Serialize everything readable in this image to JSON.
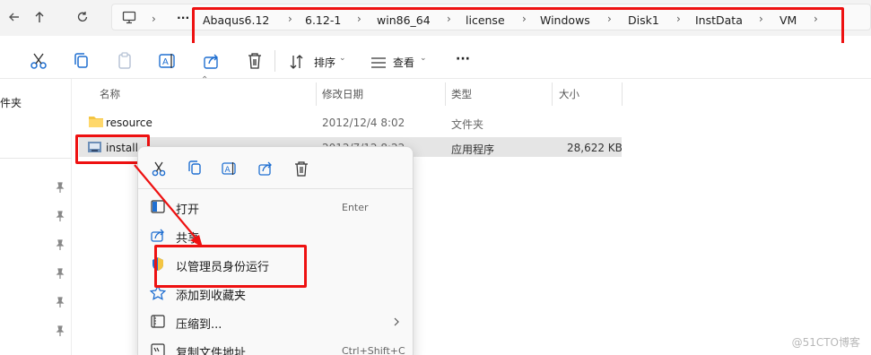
{
  "nav": {
    "back_icon": "arrow-left-icon",
    "up_icon": "arrow-up-icon",
    "refresh_icon": "refresh-icon",
    "pc_icon": "computer-icon",
    "more_path": "···"
  },
  "breadcrumb": [
    "Abaqus6.12",
    "6.12-1",
    "win86_64",
    "license",
    "Windows",
    "Disk1",
    "InstData",
    "VM"
  ],
  "toolbar": {
    "sort_label": "排序",
    "view_label": "查看",
    "more_label": "···"
  },
  "leftnav": {
    "folder_label": "件夹"
  },
  "columns": {
    "name": "名称",
    "modified": "修改日期",
    "type": "类型",
    "size": "大小"
  },
  "files": [
    {
      "name": "resource",
      "modified": "2012/12/4 8:02",
      "type": "文件夹",
      "size": "",
      "icon": "folder-icon"
    },
    {
      "name": "install",
      "modified": "2012/7/12 8:22",
      "type": "应用程序",
      "size": "28,622 KB",
      "icon": "installer-icon"
    }
  ],
  "context_menu": {
    "items": [
      {
        "label": "打开",
        "shortcut": "Enter",
        "icon": "open-icon"
      },
      {
        "label": "共享",
        "shortcut": "",
        "icon": "share-icon"
      },
      {
        "label": "以管理员身份运行",
        "shortcut": "",
        "icon": "shield-icon"
      },
      {
        "label": "添加到收藏夹",
        "shortcut": "",
        "icon": "star-icon"
      },
      {
        "label": "压缩到...",
        "shortcut": "",
        "icon": "zip-icon"
      },
      {
        "label": "复制文件地址",
        "shortcut": "Ctrl+Shift+C",
        "icon": "copy-path-icon"
      }
    ]
  },
  "watermark": "@51CTO博客",
  "colors": {
    "highlight_red": "#ee1111",
    "selected_row": "#e5e5e5",
    "folder_yellow": "#f4c542",
    "accent_blue": "#1f6fd1"
  }
}
